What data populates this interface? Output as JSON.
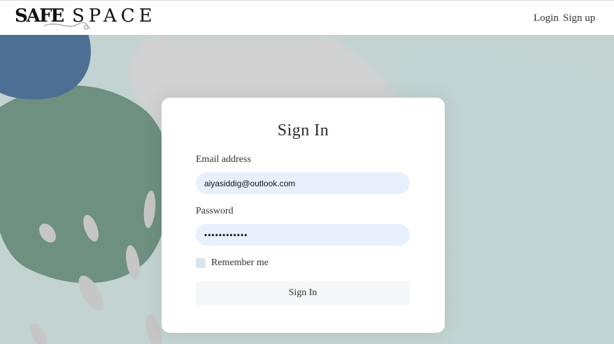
{
  "header": {
    "logo_bold": "SAFE",
    "logo_light": "SPACE",
    "nav_login": "Login",
    "nav_signup": "Sign up"
  },
  "form": {
    "title": "Sign In",
    "email_label": "Email address",
    "email_value": "aiyasiddig@outlook.com",
    "password_label": "Password",
    "password_value": "••••••••••••",
    "remember_label": "Remember me",
    "remember_checked": false,
    "submit_label": "Sign In"
  }
}
